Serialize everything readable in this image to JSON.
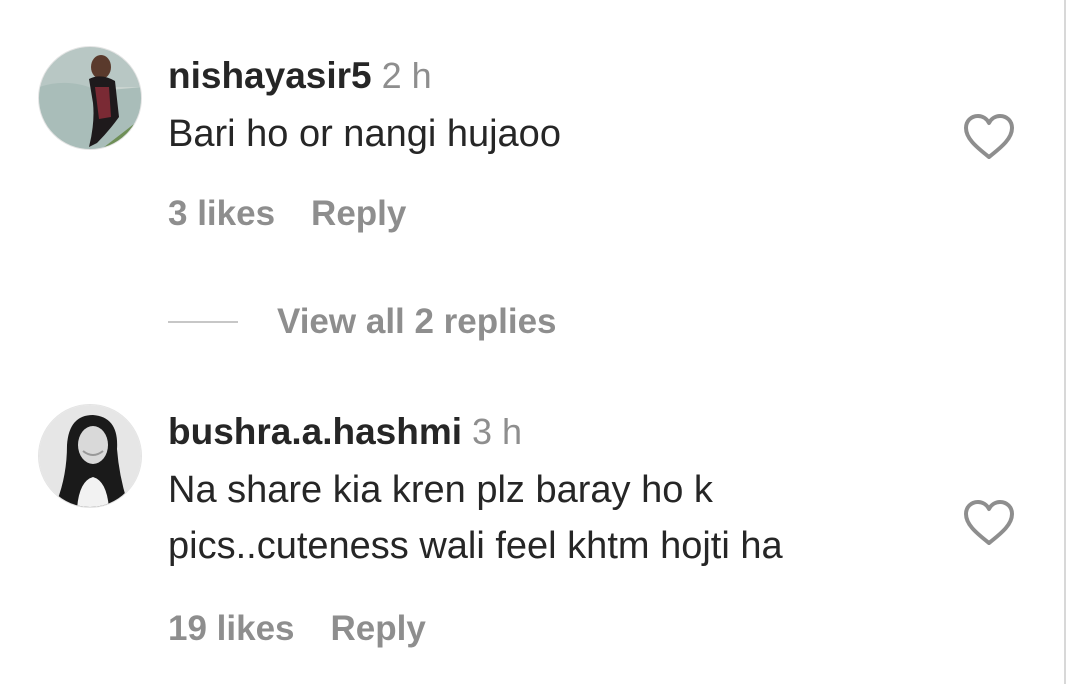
{
  "comments": [
    {
      "username": "nishayasir5",
      "time": "2 h",
      "text_lines": [
        "Bari ho or nangi hujaoo"
      ],
      "likes": "3 likes",
      "reply_label": "Reply",
      "view_replies": "View all 2 replies"
    },
    {
      "username": "bushra.a.hashmi",
      "time": "3 h",
      "text_lines": [
        "Na share kia kren plz baray ho k",
        "pics..cuteness wali feel khtm hojti ha"
      ],
      "likes": "19 likes",
      "reply_label": "Reply"
    }
  ],
  "icons": {
    "like": "heart-outline-icon"
  },
  "colors": {
    "primary_text": "#262626",
    "secondary_text": "#8e8e8e",
    "divider": "#c7c7c7"
  }
}
